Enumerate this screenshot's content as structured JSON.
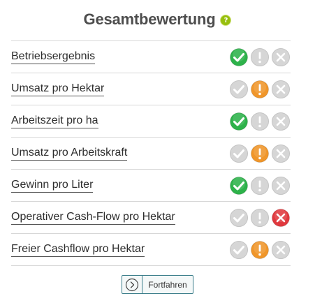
{
  "header": {
    "title": "Gesamtbewertung",
    "help_icon": "question-icon",
    "help_color": "#97bf0d"
  },
  "colors": {
    "ok": "#2db24a",
    "warning": "#f0962a",
    "error": "#e0393e",
    "inactive": "#d6d6d6",
    "accent": "#3b7e8a"
  },
  "rows": [
    {
      "label": "Betriebsergebnis",
      "status": "ok"
    },
    {
      "label": "Umsatz pro Hektar",
      "status": "warning"
    },
    {
      "label": "Arbeitszeit pro ha",
      "status": "ok"
    },
    {
      "label": "Umsatz pro Arbeitskraft",
      "status": "warning"
    },
    {
      "label": "Gewinn pro Liter",
      "status": "ok"
    },
    {
      "label": "Operativer Cash-Flow pro Hektar",
      "status": "error"
    },
    {
      "label": "Freier Cashflow pro Hektar",
      "status": "warning"
    }
  ],
  "continue_button": {
    "label": "Fortfahren",
    "icon": "chevron-right-circle-icon"
  }
}
